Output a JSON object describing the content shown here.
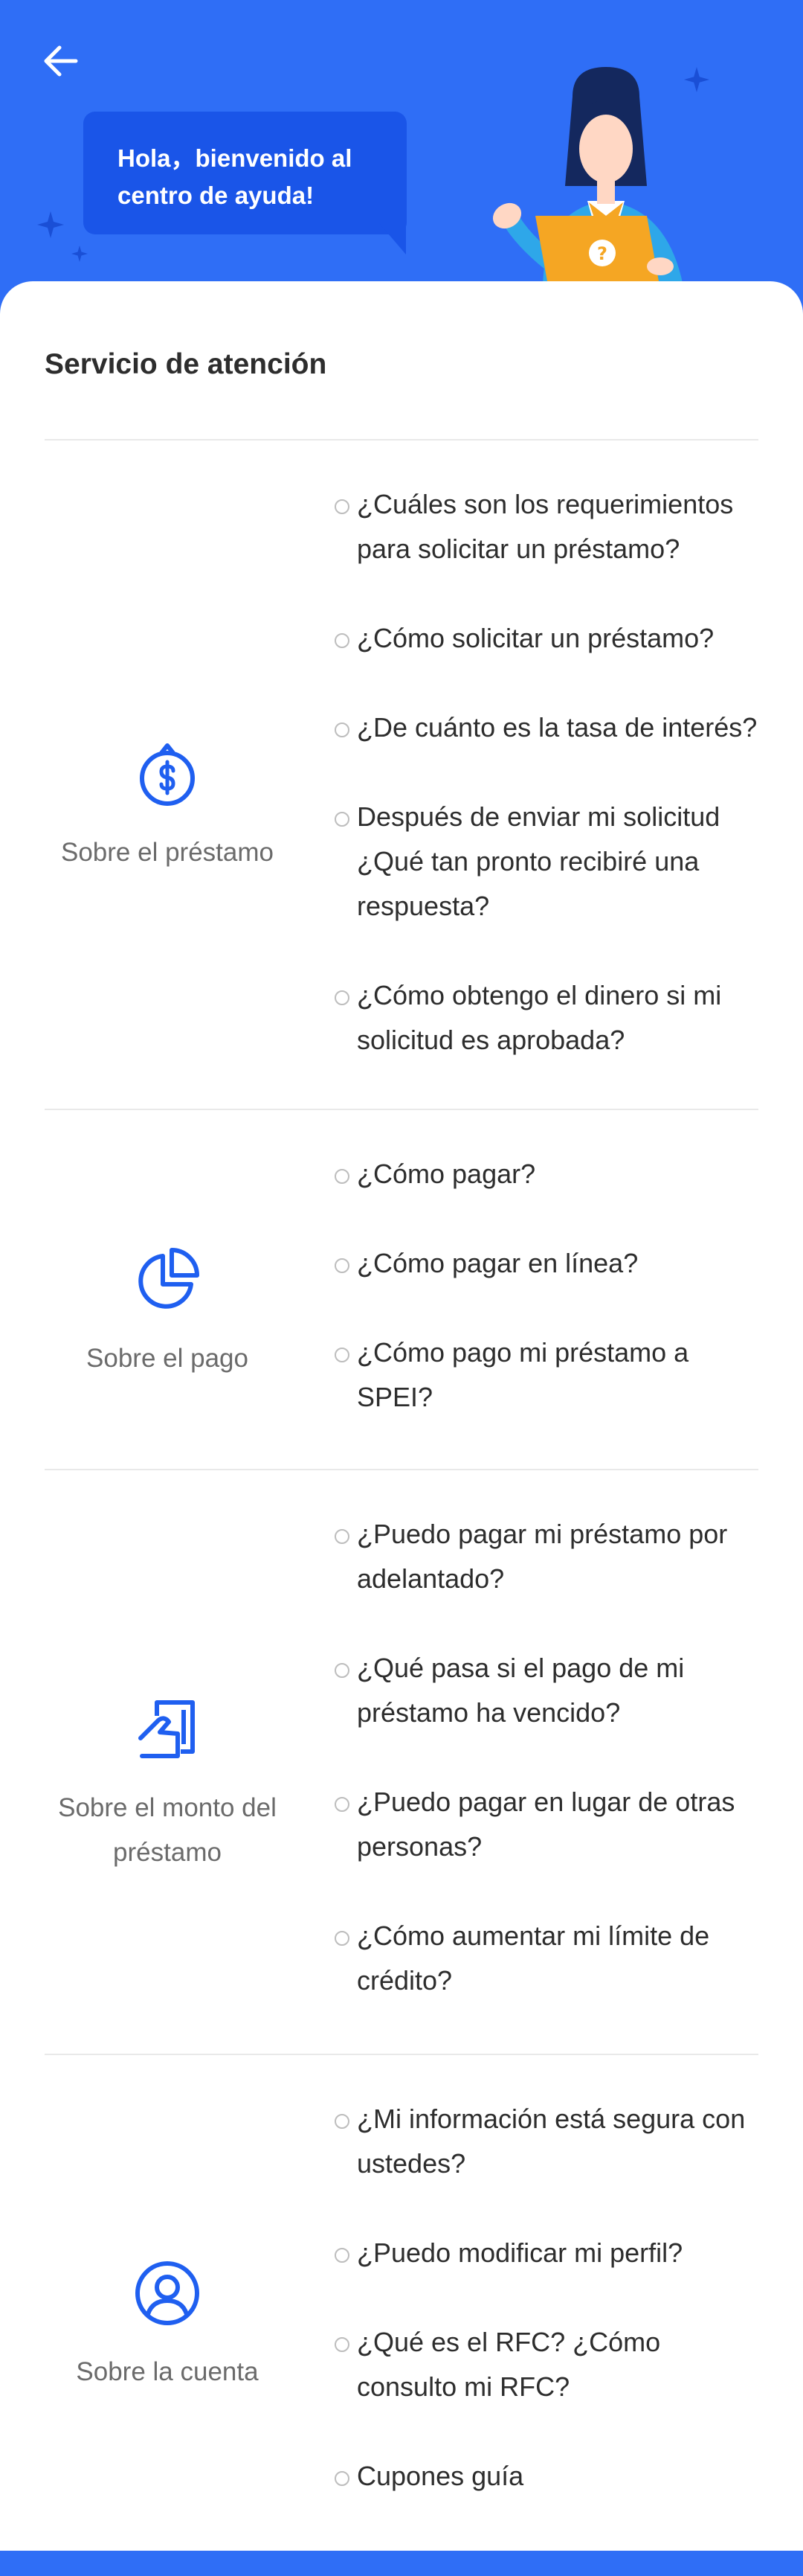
{
  "header": {
    "greeting": "Hola，bienvenido al centro de ayuda!"
  },
  "card": {
    "title": "Servicio de atención"
  },
  "sections": [
    {
      "label": "Sobre el préstamo",
      "icon": "money-bag-icon",
      "questions": [
        "¿Cuáles son los requerimientos para solicitar un préstamo?",
        "¿Cómo solicitar un préstamo?",
        "¿De cuánto es la tasa de interés?",
        "Después de enviar mi solicitud ¿Qué tan pronto recibiré una respuesta?",
        "¿Cómo obtengo el dinero si mi solicitud es aprobada?"
      ]
    },
    {
      "label": "Sobre el pago",
      "icon": "pie-chart-icon",
      "questions": [
        "¿Cómo pagar?",
        "¿Cómo pagar en línea?",
        "¿Cómo pago mi préstamo a SPEI?"
      ]
    },
    {
      "label": "Sobre el monto del préstamo",
      "icon": "hand-card-icon",
      "questions": [
        "¿Puedo pagar mi préstamo por adelantado?",
        "¿Qué pasa si el pago de mi préstamo ha vencido?",
        "¿Puedo pagar en lugar de otras personas?",
        "¿Cómo aumentar mi límite de crédito?"
      ]
    },
    {
      "label": "Sobre la cuenta",
      "icon": "user-icon",
      "questions": [
        "¿Mi información está segura con ustedes?",
        "¿Puedo modificar mi perfil?",
        "¿Qué es el RFC? ¿Cómo consulto mi RFC?",
        "Cupones guía"
      ]
    }
  ],
  "colors": {
    "primary": "#2f6ef6",
    "bubble": "#1a55e8",
    "icon_blue": "#1f5ff0"
  }
}
